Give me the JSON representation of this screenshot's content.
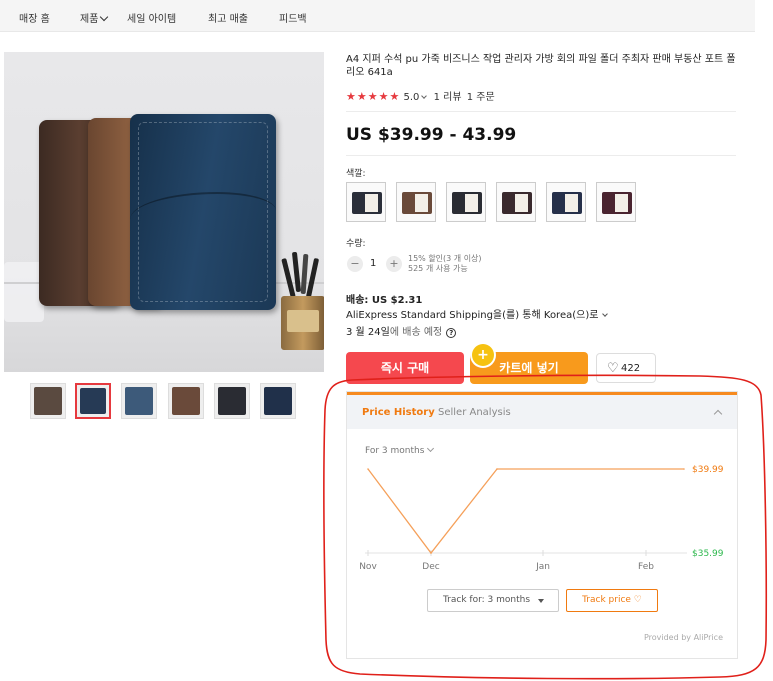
{
  "nav": {
    "items": [
      {
        "label": "매장 홈"
      },
      {
        "label": "제품"
      },
      {
        "label": "세일 아이템"
      },
      {
        "label": "최고 매출"
      },
      {
        "label": "피드백"
      }
    ]
  },
  "product": {
    "title": "A4 지퍼 수석 pu 가죽 비즈니스 작업 관리자 가방 회의 파일 폴더 주최자 판매 부동산 포트 폴리오 641a",
    "rating": {
      "stars": "★★★★★",
      "score": "5.0",
      "reviews": "1 리뷰",
      "orders": "1 주문"
    },
    "price": "US $39.99 - 43.99",
    "color_label": "색깔:",
    "swatch_colors": [
      "#2b2f3a",
      "#6a4a3a",
      "#2a2c33",
      "#3a2a2e",
      "#26304a",
      "#4a2430"
    ],
    "thumb_colors": [
      "#5a4a40",
      "#263a55",
      "#3d5a7a",
      "#6a4a3a",
      "#2a2c33",
      "#20304a"
    ],
    "quantity": {
      "label": "수량:",
      "minus": "−",
      "plus": "+",
      "value": "1",
      "discount_note": "15% 할인(3 개 이상)",
      "available": "525 개 사용 가능"
    },
    "shipping": {
      "cost": "배송: US $2.31",
      "method": "AliExpress Standard Shipping을(를) 통해 Korea(으)로",
      "delivery_prefix": "3 월 24일",
      "delivery_suffix": "에 배송 예정"
    },
    "buttons": {
      "buy_now": "즉시 구매",
      "add_to_cart": "카트에 넣기",
      "wishlist_count": "422"
    }
  },
  "price_history": {
    "tab_active": "Price History",
    "tab_other": "Seller Analysis",
    "range_label": "For 3 months",
    "track_select": "Track for: 3 months",
    "track_button": "Track price ♡",
    "provided_by": "Provided by AliPrice",
    "chart_data": {
      "type": "line",
      "x": [
        "Nov",
        "Dec",
        "Jan",
        "Feb"
      ],
      "series": [
        {
          "points": [
            {
              "x": "Nov",
              "y": 39.99
            },
            {
              "x": "Dec",
              "y": 35.99
            },
            {
              "x": "Dec–Jan",
              "y": 39.99
            },
            {
              "x": "Feb+",
              "y": 39.99
            }
          ]
        }
      ],
      "max_label": "$39.99",
      "min_label": "$35.99",
      "ylim": [
        35.99,
        39.99
      ],
      "line_color": "#f5a05a",
      "max_color": "#f07a10",
      "min_color": "#2db84d"
    }
  },
  "annotation_color": "#e0201a"
}
